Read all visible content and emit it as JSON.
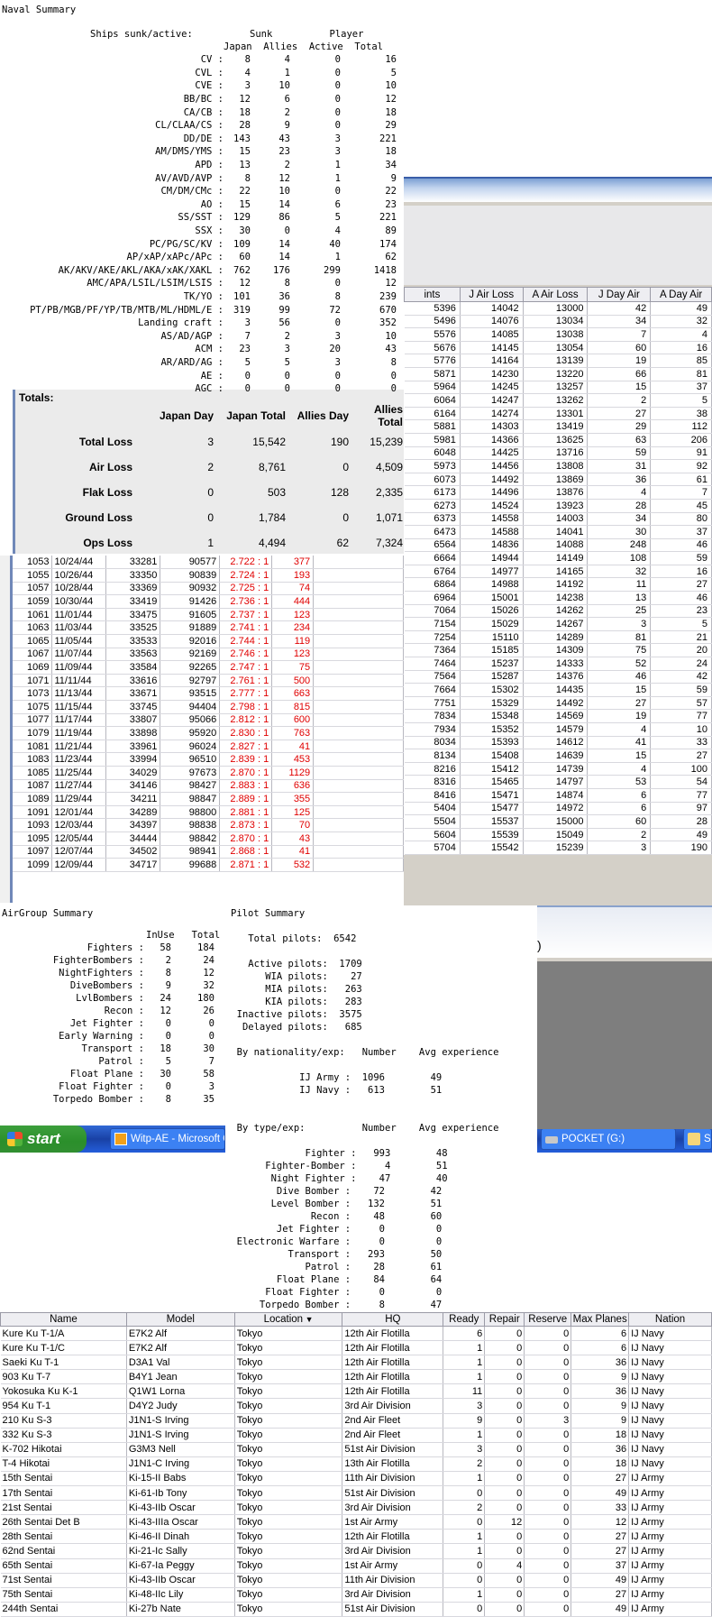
{
  "naval": {
    "title": "Naval Summary",
    "header1": "Ships sunk/active:          Sunk          Player",
    "header2": "Japan  Allies  Active  Total",
    "rows": [
      [
        "CV :",
        "8",
        "4",
        "0",
        "16"
      ],
      [
        "CVL :",
        "4",
        "1",
        "0",
        "5"
      ],
      [
        "CVE :",
        "3",
        "10",
        "0",
        "10"
      ],
      [
        "BB/BC :",
        "12",
        "6",
        "0",
        "12"
      ],
      [
        "CA/CB :",
        "18",
        "2",
        "0",
        "18"
      ],
      [
        "CL/CLAA/CS :",
        "28",
        "9",
        "0",
        "29"
      ],
      [
        "DD/DE :",
        "143",
        "43",
        "3",
        "221"
      ],
      [
        "AM/DMS/YMS :",
        "15",
        "23",
        "3",
        "18"
      ],
      [
        "APD :",
        "13",
        "2",
        "1",
        "34"
      ],
      [
        "AV/AVD/AVP :",
        "8",
        "12",
        "1",
        "9"
      ],
      [
        "CM/DM/CMc :",
        "22",
        "10",
        "0",
        "22"
      ],
      [
        "AO :",
        "15",
        "14",
        "6",
        "23"
      ],
      [
        "SS/SST :",
        "129",
        "86",
        "5",
        "221"
      ],
      [
        "SSX :",
        "30",
        "0",
        "4",
        "89"
      ],
      [
        "PC/PG/SC/KV :",
        "109",
        "14",
        "40",
        "174"
      ],
      [
        "AP/xAP/xAPc/APc :",
        "60",
        "14",
        "1",
        "62"
      ],
      [
        "AK/AKV/AKE/AKL/AKA/xAK/XAKL :",
        "762",
        "176",
        "299",
        "1418"
      ],
      [
        "AMC/APA/LSIL/LSIM/LSIS :",
        "12",
        "8",
        "0",
        "12"
      ],
      [
        "TK/YO :",
        "101",
        "36",
        "8",
        "239"
      ],
      [
        "PT/PB/MGB/PF/YP/TB/MTB/ML/HDML/E :",
        "319",
        "99",
        "72",
        "670"
      ],
      [
        "Landing craft :",
        "3",
        "56",
        "0",
        "352"
      ],
      [
        "AS/AD/AGP :",
        "7",
        "2",
        "3",
        "10"
      ],
      [
        "ACM :",
        "23",
        "3",
        "20",
        "43"
      ],
      [
        "AR/ARD/AG :",
        "5",
        "5",
        "3",
        "8"
      ],
      [
        "AE :",
        "0",
        "0",
        "0",
        "0"
      ],
      [
        "AGC :",
        "0",
        "0",
        "0",
        "0"
      ]
    ]
  },
  "right_table": {
    "columns": [
      "ints",
      "J Air Loss",
      "A Air Loss",
      "J Day Air",
      "A Day Air"
    ],
    "rows": [
      [
        "5396",
        "14042",
        "13000",
        "42",
        "49"
      ],
      [
        "5496",
        "14076",
        "13034",
        "34",
        "32"
      ],
      [
        "5576",
        "14085",
        "13038",
        "7",
        "4"
      ],
      [
        "5676",
        "14145",
        "13054",
        "60",
        "16"
      ],
      [
        "5776",
        "14164",
        "13139",
        "19",
        "85"
      ],
      [
        "5871",
        "14230",
        "13220",
        "66",
        "81"
      ],
      [
        "5964",
        "14245",
        "13257",
        "15",
        "37"
      ],
      [
        "6064",
        "14247",
        "13262",
        "2",
        "5"
      ],
      [
        "6164",
        "14274",
        "13301",
        "27",
        "38"
      ],
      [
        "5881",
        "14303",
        "13419",
        "29",
        "112"
      ],
      [
        "5981",
        "14366",
        "13625",
        "63",
        "206"
      ],
      [
        "6048",
        "14425",
        "13716",
        "59",
        "91"
      ],
      [
        "5973",
        "14456",
        "13808",
        "31",
        "92"
      ],
      [
        "6073",
        "14492",
        "13869",
        "36",
        "61"
      ],
      [
        "6173",
        "14496",
        "13876",
        "4",
        "7"
      ],
      [
        "6273",
        "14524",
        "13923",
        "28",
        "45"
      ],
      [
        "6373",
        "14558",
        "14003",
        "34",
        "80"
      ],
      [
        "6473",
        "14588",
        "14041",
        "30",
        "37"
      ],
      [
        "6564",
        "14836",
        "14088",
        "248",
        "46"
      ],
      [
        "6664",
        "14944",
        "14149",
        "108",
        "59"
      ],
      [
        "6764",
        "14977",
        "14165",
        "32",
        "16"
      ],
      [
        "6864",
        "14988",
        "14192",
        "11",
        "27"
      ],
      [
        "6964",
        "15001",
        "14238",
        "13",
        "46"
      ],
      [
        "7064",
        "15026",
        "14262",
        "25",
        "23"
      ],
      [
        "7154",
        "15029",
        "14267",
        "3",
        "5"
      ],
      [
        "7254",
        "15110",
        "14289",
        "81",
        "21"
      ],
      [
        "7364",
        "15185",
        "14309",
        "75",
        "20"
      ],
      [
        "7464",
        "15237",
        "14333",
        "52",
        "24"
      ],
      [
        "7564",
        "15287",
        "14376",
        "46",
        "42"
      ],
      [
        "7664",
        "15302",
        "14435",
        "15",
        "59"
      ],
      [
        "7751",
        "15329",
        "14492",
        "27",
        "57"
      ],
      [
        "7834",
        "15348",
        "14569",
        "19",
        "77"
      ],
      [
        "7934",
        "15352",
        "14579",
        "4",
        "10"
      ],
      [
        "8034",
        "15393",
        "14612",
        "41",
        "33"
      ],
      [
        "8134",
        "15408",
        "14639",
        "15",
        "27"
      ],
      [
        "8216",
        "15412",
        "14739",
        "4",
        "100"
      ],
      [
        "8316",
        "15465",
        "14797",
        "53",
        "54"
      ],
      [
        "8416",
        "15471",
        "14874",
        "6",
        "77"
      ],
      [
        "5404",
        "15477",
        "14972",
        "6",
        "97"
      ],
      [
        "5504",
        "15537",
        "15000",
        "60",
        "28"
      ],
      [
        "5604",
        "15539",
        "15049",
        "2",
        "49"
      ],
      [
        "5704",
        "15542",
        "15239",
        "3",
        "190"
      ]
    ]
  },
  "totals": {
    "title": "Totals:",
    "columns": [
      "Japan Day",
      "Japan Total",
      "Allies Day",
      "Allies Total"
    ],
    "rows": [
      [
        "Total Loss",
        "3",
        "15,542",
        "190",
        "15,239"
      ],
      [
        "Air Loss",
        "2",
        "8,761",
        "0",
        "4,509"
      ],
      [
        "Flak Loss",
        "0",
        "503",
        "128",
        "2,335"
      ],
      [
        "Ground Loss",
        "0",
        "1,784",
        "0",
        "1,071"
      ],
      [
        "Ops Loss",
        "1",
        "4,494",
        "62",
        "7,324"
      ]
    ]
  },
  "left_table": {
    "rows": [
      [
        "1053",
        "10/24/44",
        "33281",
        "90577",
        "2.722 : 1",
        "377"
      ],
      [
        "1055",
        "10/26/44",
        "33350",
        "90839",
        "2.724 : 1",
        "193"
      ],
      [
        "1057",
        "10/28/44",
        "33369",
        "90932",
        "2.725 : 1",
        "74"
      ],
      [
        "1059",
        "10/30/44",
        "33419",
        "91426",
        "2.736 : 1",
        "444"
      ],
      [
        "1061",
        "11/01/44",
        "33475",
        "91605",
        "2.737 : 1",
        "123"
      ],
      [
        "1063",
        "11/03/44",
        "33525",
        "91889",
        "2.741 : 1",
        "234"
      ],
      [
        "1065",
        "11/05/44",
        "33533",
        "92016",
        "2.744 : 1",
        "119"
      ],
      [
        "1067",
        "11/07/44",
        "33563",
        "92169",
        "2.746 : 1",
        "123"
      ],
      [
        "1069",
        "11/09/44",
        "33584",
        "92265",
        "2.747 : 1",
        "75"
      ],
      [
        "1071",
        "11/11/44",
        "33616",
        "92797",
        "2.761 : 1",
        "500"
      ],
      [
        "1073",
        "11/13/44",
        "33671",
        "93515",
        "2.777 : 1",
        "663"
      ],
      [
        "1075",
        "11/15/44",
        "33745",
        "94404",
        "2.798 : 1",
        "815"
      ],
      [
        "1077",
        "11/17/44",
        "33807",
        "95066",
        "2.812 : 1",
        "600"
      ],
      [
        "1079",
        "11/19/44",
        "33898",
        "95920",
        "2.830 : 1",
        "763"
      ],
      [
        "1081",
        "11/21/44",
        "33961",
        "96024",
        "2.827 : 1",
        "41"
      ],
      [
        "1083",
        "11/23/44",
        "33994",
        "96510",
        "2.839 : 1",
        "453"
      ],
      [
        "1085",
        "11/25/44",
        "34029",
        "97673",
        "2.870 : 1",
        "1129"
      ],
      [
        "1087",
        "11/27/44",
        "34146",
        "98427",
        "2.883 : 1",
        "636"
      ],
      [
        "1089",
        "11/29/44",
        "34211",
        "98847",
        "2.889 : 1",
        "355"
      ],
      [
        "1091",
        "12/01/44",
        "34289",
        "98800",
        "2.881 : 1",
        "125"
      ],
      [
        "1093",
        "12/03/44",
        "34397",
        "98838",
        "2.873 : 1",
        "70"
      ],
      [
        "1095",
        "12/05/44",
        "34444",
        "98842",
        "2.870 : 1",
        "43"
      ],
      [
        "1097",
        "12/07/44",
        "34502",
        "98941",
        "2.868 : 1",
        "41"
      ],
      [
        "1099",
        "12/09/44",
        "34717",
        "99688",
        "2.871 : 1",
        "532"
      ]
    ]
  },
  "airgroup": {
    "title": "AirGroup Summary",
    "header": "InUse   Total",
    "rows": [
      [
        "Fighters :",
        "58",
        "184"
      ],
      [
        "FighterBombers :",
        "2",
        "24"
      ],
      [
        "NightFighters :",
        "8",
        "12"
      ],
      [
        "DiveBombers :",
        "9",
        "32"
      ],
      [
        "LvlBombers :",
        "24",
        "180"
      ],
      [
        "Recon :",
        "12",
        "26"
      ],
      [
        "Jet Fighter :",
        "0",
        "0"
      ],
      [
        "Early Warning :",
        "0",
        "0"
      ],
      [
        "Transport :",
        "18",
        "30"
      ],
      [
        "Patrol :",
        "5",
        "7"
      ],
      [
        "Float Plane :",
        "30",
        "58"
      ],
      [
        "Float Fighter :",
        "0",
        "3"
      ],
      [
        "Torpedo Bomber :",
        "8",
        "35"
      ]
    ]
  },
  "pilot": {
    "title": "Pilot Summary",
    "total": "    Total pilots:  6542",
    "status": "    Active pilots:  1709\n       WIA pilots:    27\n       MIA pilots:   263\n       KIA pilots:   283\n  Inactive pilots:  3575\n   Delayed pilots:   685",
    "nat_header": "  By nationality/exp:   Number    Avg experience",
    "nat_rows": "             IJ Army :  1096        49\n             IJ Navy :   613        51",
    "type_header": "  By type/exp:          Number    Avg experience",
    "type_rows": "              Fighter :   993        48\n       Fighter-Bomber :     4        51\n        Night Fighter :    47        40\n         Dive Bomber :    72        42\n        Level Bomber :   132        51\n               Recon :    48        60\n         Jet Fighter :     0         0\n  Electronic Warfare :     0         0\n           Transport :   293        50\n              Patrol :    28        61\n         Float Plane :    84        64\n       Float Fighter :     0         0\n      Torpedo Bomber :     8        47"
  },
  "darkwin": {
    "paren": ")"
  },
  "taskbar": {
    "start_label": "start",
    "items": [
      "Witp-AE - Microsoft O...",
      "POCKET (G:)",
      "S"
    ],
    "colors": {
      "bar": "#245edb",
      "start": "#3c9f3c"
    }
  },
  "grid": {
    "columns": [
      "Name",
      "Model",
      "Location",
      "HQ",
      "Ready",
      "Repair",
      "Reserve",
      "Max Planes",
      "Nation"
    ],
    "sort_indicator": "▼",
    "rows": [
      [
        "Kure Ku T-1/A",
        "E7K2 Alf",
        "Tokyo",
        "12th Air Flotilla",
        "6",
        "0",
        "0",
        "6",
        "IJ Navy"
      ],
      [
        "Kure Ku T-1/C",
        "E7K2 Alf",
        "Tokyo",
        "12th Air Flotilla",
        "1",
        "0",
        "0",
        "6",
        "IJ Navy"
      ],
      [
        "Saeki Ku T-1",
        "D3A1 Val",
        "Tokyo",
        "12th Air Flotilla",
        "1",
        "0",
        "0",
        "36",
        "IJ Navy"
      ],
      [
        "903 Ku T-7",
        "B4Y1 Jean",
        "Tokyo",
        "12th Air Flotilla",
        "1",
        "0",
        "0",
        "9",
        "IJ Navy"
      ],
      [
        "Yokosuka Ku K-1",
        "Q1W1 Lorna",
        "Tokyo",
        "12th Air Flotilla",
        "11",
        "0",
        "0",
        "36",
        "IJ Navy"
      ],
      [
        "954 Ku T-1",
        "D4Y2 Judy",
        "Tokyo",
        "3rd Air Division",
        "3",
        "0",
        "0",
        "9",
        "IJ Navy"
      ],
      [
        "210 Ku S-3",
        "J1N1-S Irving",
        "Tokyo",
        "2nd Air Fleet",
        "9",
        "0",
        "3",
        "9",
        "IJ Navy"
      ],
      [
        "332 Ku S-3",
        "J1N1-S Irving",
        "Tokyo",
        "2nd Air Fleet",
        "1",
        "0",
        "0",
        "18",
        "IJ Navy"
      ],
      [
        "K-702 Hikotai",
        "G3M3 Nell",
        "Tokyo",
        "51st Air Division",
        "3",
        "0",
        "0",
        "36",
        "IJ Navy"
      ],
      [
        "T-4 Hikotai",
        "J1N1-C Irving",
        "Tokyo",
        "13th Air Flotilla",
        "2",
        "0",
        "0",
        "18",
        "IJ Navy"
      ],
      [
        "15th Sentai",
        "Ki-15-II Babs",
        "Tokyo",
        "11th Air Division",
        "1",
        "0",
        "0",
        "27",
        "IJ Army"
      ],
      [
        "17th Sentai",
        "Ki-61-Ib Tony",
        "Tokyo",
        "51st Air Division",
        "0",
        "0",
        "0",
        "49",
        "IJ Army"
      ],
      [
        "21st Sentai",
        "Ki-43-IIb Oscar",
        "Tokyo",
        "3rd Air Division",
        "2",
        "0",
        "0",
        "33",
        "IJ Army"
      ],
      [
        "26th Sentai Det B",
        "Ki-43-IIIa Oscar",
        "Tokyo",
        "1st Air Army",
        "0",
        "12",
        "0",
        "12",
        "IJ Army"
      ],
      [
        "28th Sentai",
        "Ki-46-II Dinah",
        "Tokyo",
        "12th Air Flotilla",
        "1",
        "0",
        "0",
        "27",
        "IJ Army"
      ],
      [
        "62nd Sentai",
        "Ki-21-Ic Sally",
        "Tokyo",
        "3rd Air Division",
        "1",
        "0",
        "0",
        "27",
        "IJ Army"
      ],
      [
        "65th Sentai",
        "Ki-67-Ia Peggy",
        "Tokyo",
        "1st Air Army",
        "0",
        "4",
        "0",
        "37",
        "IJ Army"
      ],
      [
        "71st Sentai",
        "Ki-43-IIb Oscar",
        "Tokyo",
        "11th Air Division",
        "0",
        "0",
        "0",
        "49",
        "IJ Army"
      ],
      [
        "75th Sentai",
        "Ki-48-IIc Lily",
        "Tokyo",
        "3rd Air Division",
        "1",
        "0",
        "0",
        "27",
        "IJ Army"
      ],
      [
        "244th Sentai",
        "Ki-27b Nate",
        "Tokyo",
        "51st Air Division",
        "0",
        "0",
        "0",
        "49",
        "IJ Army"
      ]
    ]
  }
}
